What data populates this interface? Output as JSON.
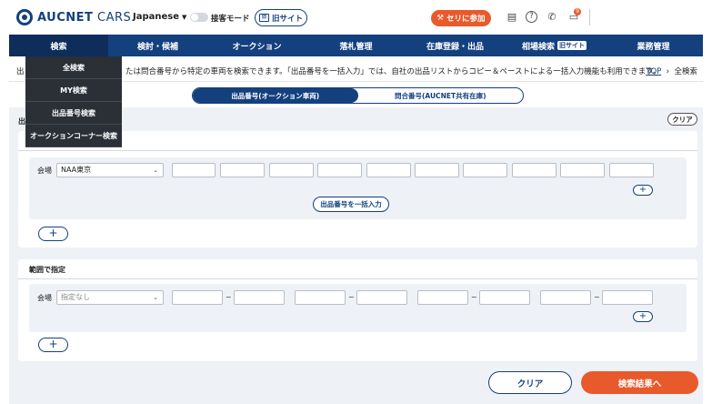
{
  "header": {
    "logo_brand": "AUCNET",
    "logo_suffix": " CARS",
    "language": "Japanese",
    "toggle_label": "接客モード",
    "old_site_label": "旧サイト",
    "join_button": "セリに参加",
    "notification_count": "9"
  },
  "nav": {
    "items": [
      {
        "label": "検索"
      },
      {
        "label": "検討・候補"
      },
      {
        "label": "オークション"
      },
      {
        "label": "落札管理"
      },
      {
        "label": "在庫登録・出品"
      },
      {
        "label": "相場検索",
        "tag": "旧サイト"
      },
      {
        "label": "業務管理"
      }
    ]
  },
  "dropdown": {
    "items": [
      "全検索",
      "MY検索",
      "出品番号検索",
      "オークションコーナー検索"
    ]
  },
  "page": {
    "title_prefix": "出",
    "description": "たは問合番号から特定の車両を検索できます。「出品番号を一括入力」では、自社の出品リストからコピー＆ペーストによる一括入力機能も利用できます。",
    "breadcrumb_top": "TOP",
    "breadcrumb_sep": "›",
    "breadcrumb_current": "全検索"
  },
  "tabs": {
    "active": "出品番号(オークション車両)",
    "inactive": "問合番号(AUCNET共有在庫)"
  },
  "section": {
    "prefix": "出",
    "clear_small": "クリア"
  },
  "card1": {
    "venue_label": "会場",
    "venue_value": "NAA東京",
    "bulk_button": "出品番号を一括入力",
    "plus": "+"
  },
  "card2": {
    "title": "範囲で指定",
    "venue_label": "会場",
    "venue_placeholder": "指定なし",
    "tilde": "~",
    "plus": "+"
  },
  "footer": {
    "clear_button": "クリア",
    "search_button": "検索結果へ"
  },
  "colors": {
    "brand_navy": "#14407e",
    "accent_orange": "#e85a2c"
  }
}
